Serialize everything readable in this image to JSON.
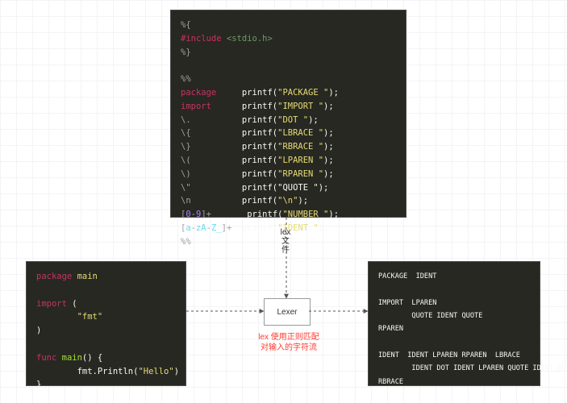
{
  "top_code": [
    [
      [
        "%{",
        "c-comment"
      ]
    ],
    [
      [
        "#include",
        "c-include"
      ],
      [
        " ",
        "c-plain"
      ],
      [
        "<stdio.h>",
        "c-angle"
      ]
    ],
    [
      [
        "%}",
        "c-comment"
      ]
    ],
    [
      [
        "",
        "c-plain"
      ]
    ],
    [
      [
        "%%",
        "c-comment"
      ]
    ],
    [
      [
        "package     ",
        "c-keyword"
      ],
      [
        "printf(",
        "c-func"
      ],
      [
        "\"PACKAGE \"",
        "c-string"
      ],
      [
        ");",
        "c-func"
      ]
    ],
    [
      [
        "import      ",
        "c-keyword"
      ],
      [
        "printf(",
        "c-func"
      ],
      [
        "\"IMPORT \"",
        "c-string"
      ],
      [
        ");",
        "c-func"
      ]
    ],
    [
      [
        "\\.          ",
        "c-comment"
      ],
      [
        "printf(",
        "c-func"
      ],
      [
        "\"DOT \"",
        "c-string"
      ],
      [
        ");",
        "c-func"
      ]
    ],
    [
      [
        "\\{          ",
        "c-comment"
      ],
      [
        "printf(",
        "c-func"
      ],
      [
        "\"LBRACE \"",
        "c-string"
      ],
      [
        ");",
        "c-func"
      ]
    ],
    [
      [
        "\\}          ",
        "c-comment"
      ],
      [
        "printf(",
        "c-func"
      ],
      [
        "\"RBRACE \"",
        "c-string"
      ],
      [
        ");",
        "c-func"
      ]
    ],
    [
      [
        "\\(          ",
        "c-comment"
      ],
      [
        "printf(",
        "c-func"
      ],
      [
        "\"LPAREN \"",
        "c-string"
      ],
      [
        ");",
        "c-func"
      ]
    ],
    [
      [
        "\\)          ",
        "c-comment"
      ],
      [
        "printf(",
        "c-func"
      ],
      [
        "\"RPAREN \"",
        "c-string"
      ],
      [
        ");",
        "c-func"
      ]
    ],
    [
      [
        "\\\"          ",
        "c-comment"
      ],
      [
        "printf(\"",
        "c-func"
      ],
      [
        "QUOTE \"",
        "c-plain"
      ],
      [
        ");",
        "c-func"
      ]
    ],
    [
      [
        "\\n          ",
        "c-comment"
      ],
      [
        "printf(",
        "c-func"
      ],
      [
        "\"\\n\"",
        "c-string"
      ],
      [
        ");",
        "c-func"
      ]
    ],
    [
      [
        "[",
        "c-comment"
      ],
      [
        "0",
        "c-num"
      ],
      [
        "-",
        "c-comment"
      ],
      [
        "9",
        "c-num"
      ],
      [
        "]+       ",
        "c-comment"
      ],
      [
        "printf(",
        "c-func"
      ],
      [
        "\"NUMBER \"",
        "c-string"
      ],
      [
        ");",
        "c-func"
      ]
    ],
    [
      [
        "[",
        "c-comment"
      ],
      [
        "a",
        "c-ident"
      ],
      [
        "-",
        "c-comment"
      ],
      [
        "zA",
        "c-ident"
      ],
      [
        "-",
        "c-comment"
      ],
      [
        "Z_",
        "c-ident"
      ],
      [
        "]+  ",
        "c-comment"
      ],
      [
        "printf(",
        "c-func"
      ],
      [
        "\"IDENT \"",
        "c-string"
      ],
      [
        ");",
        "c-func"
      ]
    ],
    [
      [
        "%%",
        "c-comment"
      ]
    ]
  ],
  "left_code": [
    [
      [
        "package",
        "c-keyword"
      ],
      [
        " ",
        "c-plain"
      ],
      [
        "main",
        "c-pkgname"
      ]
    ],
    [
      [
        "",
        "c-plain"
      ]
    ],
    [
      [
        "import",
        "c-keyword"
      ],
      [
        " (",
        "c-plain"
      ]
    ],
    [
      [
        "        ",
        "c-plain"
      ],
      [
        "\"fmt\"",
        "c-string"
      ]
    ],
    [
      [
        ")",
        "c-plain"
      ]
    ],
    [
      [
        "",
        "c-plain"
      ]
    ],
    [
      [
        "func",
        "c-keyword"
      ],
      [
        " ",
        "c-plain"
      ],
      [
        "main",
        "c-typename"
      ],
      [
        "() {",
        "c-funcdef"
      ]
    ],
    [
      [
        "        fmt.Println(",
        "c-func"
      ],
      [
        "\"Hello\"",
        "c-string"
      ],
      [
        ")",
        "c-func"
      ]
    ],
    [
      [
        "}",
        "c-plain"
      ]
    ]
  ],
  "right_code": [
    [
      [
        "PACKAGE  IDENT",
        "c-plain"
      ]
    ],
    [
      [
        "",
        "c-plain"
      ]
    ],
    [
      [
        "IMPORT  LPAREN",
        "c-plain"
      ]
    ],
    [
      [
        "        QUOTE IDENT QUOTE",
        "c-plain"
      ]
    ],
    [
      [
        "RPAREN",
        "c-plain"
      ]
    ],
    [
      [
        "",
        "c-plain"
      ]
    ],
    [
      [
        "IDENT  IDENT LPAREN RPAREN  LBRACE",
        "c-plain"
      ]
    ],
    [
      [
        "        IDENT DOT IDENT LPAREN QUOTE IDENT QUOTE RPAREN",
        "c-plain"
      ]
    ],
    [
      [
        "RBRACE",
        "c-plain"
      ]
    ]
  ],
  "lexer_label": "Lexer",
  "vlabel_chars": [
    "lex",
    "文",
    "件"
  ],
  "caption_lines": [
    "lex 使用正则匹配",
    "对输入的字符流"
  ]
}
